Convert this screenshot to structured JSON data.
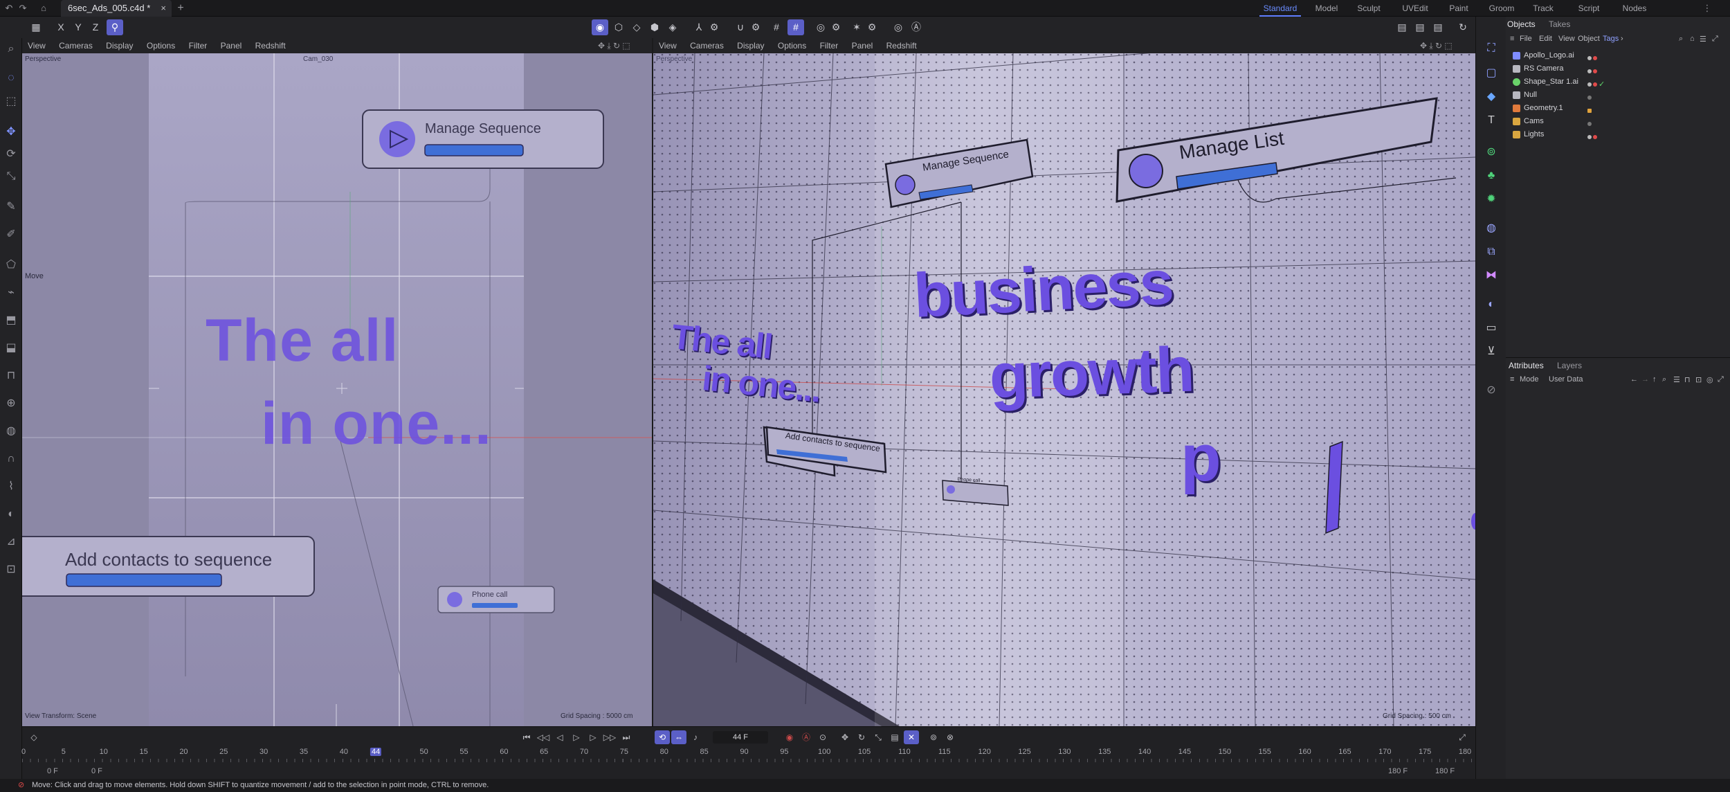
{
  "app": {
    "document_tab": "6sec_Ads_005.c4d *",
    "layouts": [
      {
        "label": "Standard",
        "active": true
      },
      {
        "label": "Model",
        "active": false
      },
      {
        "label": "Sculpt",
        "active": false
      },
      {
        "label": "UVEdit",
        "active": false
      },
      {
        "label": "Paint",
        "active": false
      },
      {
        "label": "Groom",
        "active": false
      },
      {
        "label": "Track",
        "active": false
      },
      {
        "label": "Script",
        "active": false
      },
      {
        "label": "Nodes",
        "active": false
      }
    ],
    "axis_lock": [
      "X",
      "Y",
      "Z"
    ]
  },
  "viewport_left": {
    "menu": [
      "View",
      "Cameras",
      "Display",
      "Options",
      "Filter",
      "Panel",
      "Redshift"
    ],
    "projection": "Perspective",
    "camera": "Cam_030",
    "tool_hint": "Move",
    "footer_left": "View Transform: Scene",
    "footer_right": "Grid Spacing : 5000 cm",
    "scene": {
      "card_top": "Manage Sequence",
      "headline_1": "The all",
      "headline_2": "in one...",
      "card_bottom": "Add contacts to sequence",
      "card_small": "Phone call"
    }
  },
  "viewport_right": {
    "menu": [
      "View",
      "Cameras",
      "Display",
      "Options",
      "Filter",
      "Panel",
      "Redshift"
    ],
    "projection": "Perspective",
    "footer_right": "Grid Spacing : 500 cm",
    "scene": {
      "card_manage_seq": "Manage Sequence",
      "card_manage_list": "Manage List",
      "word_business": "business",
      "word_growth": "growth",
      "headline_1": "The all",
      "headline_2": "in one...",
      "card_add_contacts": "Add contacts to sequence",
      "card_phone": "Phone call",
      "letter_p": "p"
    }
  },
  "objects_panel": {
    "tabs": [
      "Objects",
      "Takes"
    ],
    "menu": [
      "File",
      "Edit",
      "View",
      "Object",
      "Tags"
    ],
    "items": [
      {
        "name": "Apollo_Logo.ai",
        "color": "#7f8cff",
        "checked": true
      },
      {
        "name": "RS Camera",
        "color": "#b8b8c0",
        "checked": true
      },
      {
        "name": "Shape_Star 1.ai",
        "color": "#6ad36a",
        "checked": true
      },
      {
        "name": "Null",
        "color": "#b8b8c0",
        "checked": false
      },
      {
        "name": "Geometry.1",
        "color": "#e07a3c",
        "checked": false
      },
      {
        "name": "Cams",
        "color": "#d9a640",
        "checked": false
      },
      {
        "name": "Lights",
        "color": "#d9a640",
        "checked": false
      }
    ]
  },
  "attributes_panel": {
    "tabs": [
      "Attributes",
      "Layers"
    ],
    "menu": [
      "Mode",
      "User Data"
    ]
  },
  "timeline": {
    "current_frame": "44 F",
    "current_tick": "44",
    "ticks": [
      "0",
      "5",
      "10",
      "15",
      "20",
      "25",
      "30",
      "35",
      "40",
      "44",
      "50",
      "55",
      "60",
      "65",
      "70",
      "75",
      "80",
      "85",
      "90",
      "95",
      "100",
      "105",
      "110",
      "115",
      "120",
      "125",
      "130",
      "135",
      "140",
      "145",
      "150",
      "155",
      "160",
      "165",
      "170",
      "175",
      "180"
    ],
    "start_a": "0 F",
    "start_b": "0 F",
    "end_a": "180 F",
    "end_b": "180 F"
  },
  "status": {
    "message": "Move: Click and drag to move elements. Hold down SHIFT to quantize movement / add to the selection in point mode, CTRL to remove."
  },
  "colors": {
    "accent": "#5b5fc7",
    "text_purple": "#6b4fe0",
    "bar_blue": "#3f6fd6"
  }
}
